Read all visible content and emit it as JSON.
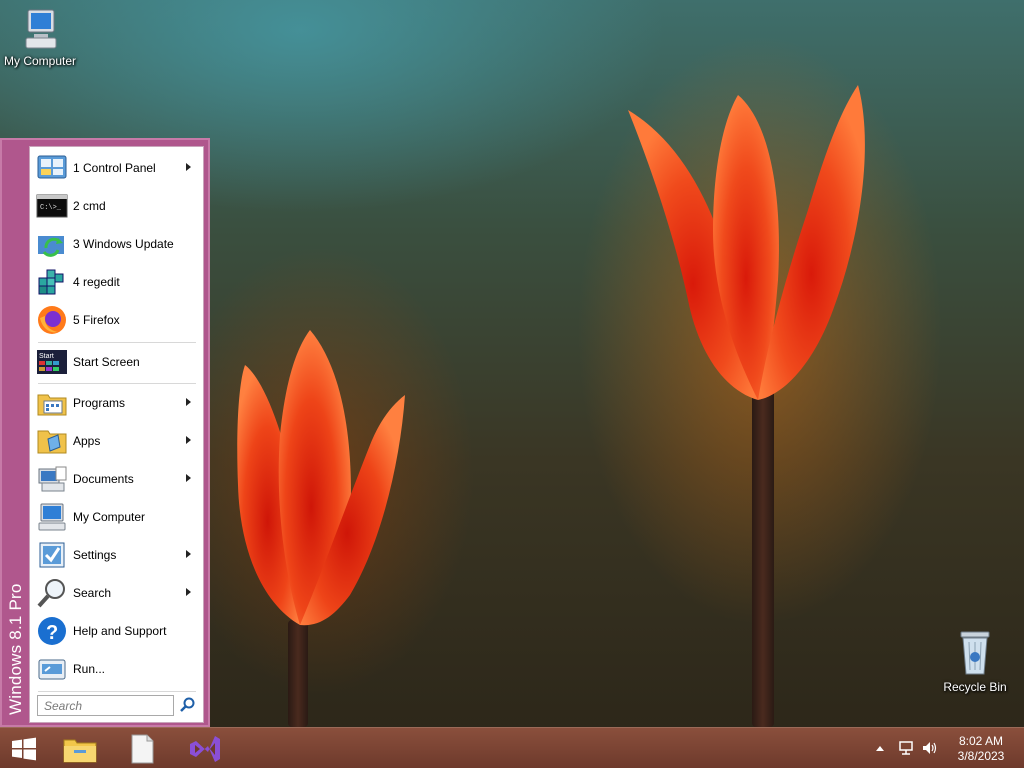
{
  "desktop": {
    "icons": [
      {
        "label": "My Computer"
      },
      {
        "label": "Recycle Bin"
      }
    ]
  },
  "start_menu": {
    "brand": "Windows 8.1 Pro",
    "recent": [
      {
        "label": "1 Control Panel",
        "icon": "control-panel-icon",
        "submenu": true
      },
      {
        "label": "2 cmd",
        "icon": "cmd-icon",
        "submenu": false
      },
      {
        "label": "3 Windows Update",
        "icon": "windows-update-icon",
        "submenu": false
      },
      {
        "label": "4 regedit",
        "icon": "regedit-icon",
        "submenu": false
      },
      {
        "label": "5 Firefox",
        "icon": "firefox-icon",
        "submenu": false
      }
    ],
    "start_screen": {
      "label": "Start Screen",
      "icon_text": "Start"
    },
    "main": [
      {
        "label": "Programs",
        "icon": "programs-icon",
        "submenu": true
      },
      {
        "label": "Apps",
        "icon": "apps-icon",
        "submenu": true
      },
      {
        "label": "Documents",
        "icon": "documents-icon",
        "submenu": true
      },
      {
        "label": "My Computer",
        "icon": "my-computer-icon",
        "submenu": false
      },
      {
        "label": "Settings",
        "icon": "settings-icon",
        "submenu": true
      },
      {
        "label": "Search",
        "icon": "search-icon",
        "submenu": true
      },
      {
        "label": "Help and Support",
        "icon": "help-icon",
        "submenu": false
      },
      {
        "label": "Run...",
        "icon": "run-icon",
        "submenu": false
      }
    ],
    "search": {
      "placeholder": "Search"
    }
  },
  "taskbar": {
    "pinned": [
      "windows-start-icon",
      "file-explorer-icon",
      "blank-document-icon",
      "visual-studio-icon"
    ],
    "clock": {
      "time": "8:02 AM",
      "date": "3/8/2023"
    }
  },
  "colors": {
    "menu_frame": "#b0578d",
    "taskbar": "#7a4332"
  }
}
